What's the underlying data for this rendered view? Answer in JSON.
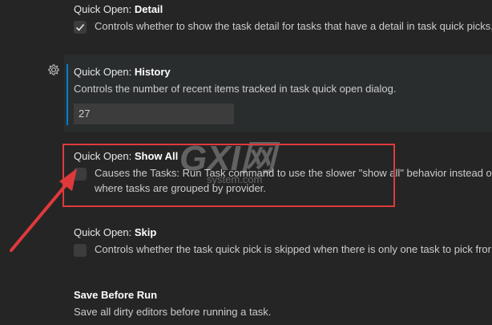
{
  "settings": {
    "detail": {
      "category": "Quick Open: ",
      "name": "Detail",
      "checked": true,
      "description": "Controls whether to show the task detail for tasks that have a detail in task quick picks,"
    },
    "history": {
      "category": "Quick Open: ",
      "name": "History",
      "description": "Controls the number of recent items tracked in task quick open dialog.",
      "value": "27"
    },
    "show_all": {
      "category": "Quick Open: ",
      "name": "Show All",
      "checked": false,
      "description_line1": "Causes the Tasks: Run Task command to use the slower \"show all\" behavior instead of",
      "description_line2": "where tasks are grouped by provider."
    },
    "skip": {
      "category": "Quick Open: ",
      "name": "Skip",
      "checked": false,
      "description": "Controls whether the task quick pick is skipped when there is only one task to pick fror"
    },
    "save_before_run": {
      "name": "Save Before Run",
      "description": "Save all dirty editors before running a task."
    }
  },
  "watermark": {
    "text": "GXI网",
    "subtext": "system.com"
  },
  "colors": {
    "background": "#252526",
    "focus_bar": "#007fd4",
    "highlight": "#e0393b",
    "checkbox_bg": "#3c3c3c"
  },
  "icons": {
    "gear": "gear-icon",
    "check": "checkmark-icon",
    "arrow": "red-arrow-annotation"
  }
}
